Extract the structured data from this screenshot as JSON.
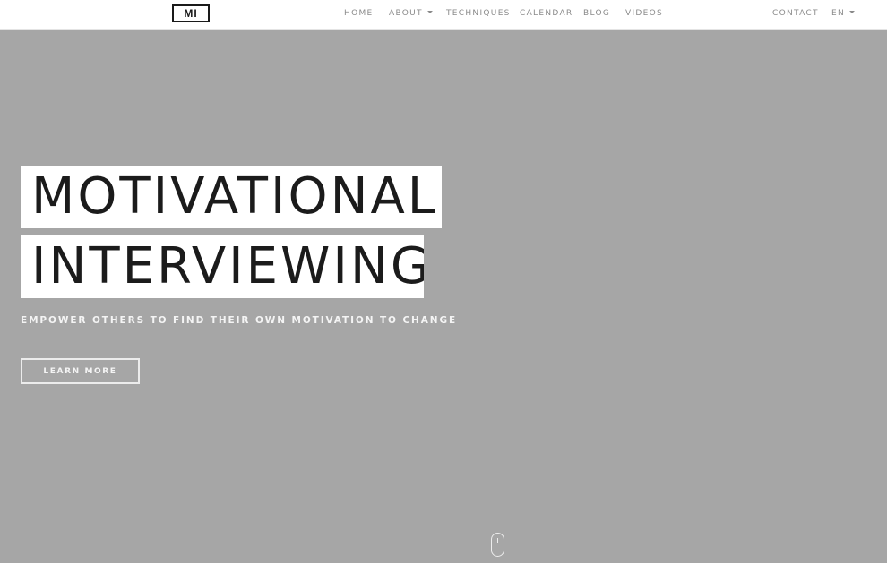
{
  "navbar": {
    "logo_text": "MI",
    "links": {
      "home": "HOME",
      "about": "ABOUT",
      "techniques": "TECHNIQUES",
      "calendar": "CALENDAR",
      "blog": "BLOG",
      "videos": "VIDEOS",
      "contact": "CONTACT",
      "language": "EN"
    }
  },
  "hero": {
    "title_line_1": "MOTIVATIONAL",
    "title_line_2": "INTERVIEWING",
    "tagline": "EMPOWER OTHERS TO FIND THEIR OWN MOTIVATION TO CHANGE",
    "cta_label": "LEARN MORE",
    "background_color": "#a6a6a6",
    "scroll_icon": "mouse-scroll-icon"
  }
}
